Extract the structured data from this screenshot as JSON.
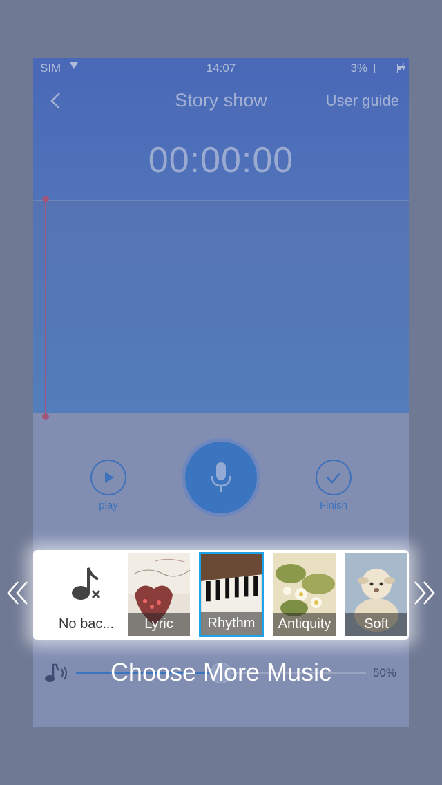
{
  "status_bar": {
    "carrier": "SIM",
    "time": "14:07",
    "battery": "3%"
  },
  "nav": {
    "title": "Story show",
    "user_guide": "User guide"
  },
  "timer": "00:00:00",
  "controls": {
    "play_label": "play",
    "finish_label": "Finish"
  },
  "volume": {
    "percent_label": "50%",
    "level": 0.5
  },
  "music_panel": {
    "items": [
      {
        "label": "No bac...",
        "icon": "music-note-off-icon",
        "selected": false
      },
      {
        "label": "Lyric",
        "selected": false
      },
      {
        "label": "Rhythm",
        "selected": true
      },
      {
        "label": "Antiquity",
        "selected": false
      },
      {
        "label": "Soft",
        "selected": false
      }
    ],
    "choose_more": "Choose More Music"
  },
  "colors": {
    "accent": "#2a74cd",
    "selection": "#1fa3e8",
    "cursor": "#b04a72"
  }
}
